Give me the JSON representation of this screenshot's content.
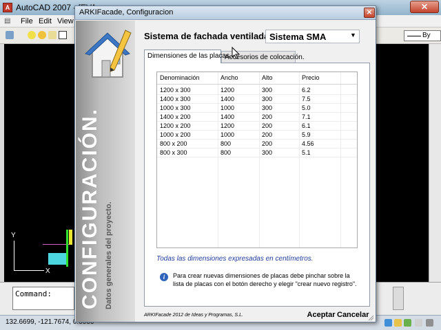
{
  "acad": {
    "app_icon": "A",
    "title": "AutoCAD 2007 - [EVA",
    "close_glyph": "✕",
    "menu": [
      "File",
      "Edit",
      "View"
    ],
    "toolbar_right_combo": "By",
    "axis_y": "Y",
    "axis_x": "X",
    "command_prompt": "Command:",
    "status_coords": "132.6699, -121.7674, 0.0000",
    "icons": [
      "autocad-logo-icon",
      "layer-light-icon",
      "sun-icon",
      "lock-icon",
      "color-swatch-icon",
      "lineweight-icon",
      "tray-icon"
    ]
  },
  "dialog": {
    "title": "ARKIFacade, Configuracion",
    "close_glyph": "✕",
    "sidebar": {
      "title": "CONFIGURACIÓN.",
      "subtitle": "Datos generales del proyecto.",
      "logo_icon": "house-pencil-icon"
    },
    "system_label": "Sistema de fachada ventilada:",
    "system_value": "Sistema SMA",
    "dropdown_glyph": "▼",
    "tabs": [
      {
        "label": "Dimensiones de las placas.",
        "active": true
      },
      {
        "label": "Accesorios de colocación.",
        "active": false
      }
    ],
    "grid": {
      "columns": [
        "Denominación",
        "Ancho",
        "Alto",
        "Precio"
      ],
      "rows": [
        [
          "1200 x 300",
          "1200",
          "300",
          "6.2"
        ],
        [
          "1400 x 300",
          "1400",
          "300",
          "7.5"
        ],
        [
          "1000 x 300",
          "1000",
          "300",
          "5.0"
        ],
        [
          "1400 x 200",
          "1400",
          "200",
          "7.1"
        ],
        [
          "1200 x 200",
          "1200",
          "200",
          "6.1"
        ],
        [
          "1000 x 200",
          "1000",
          "200",
          "5.9"
        ],
        [
          "800 x 200",
          "800",
          "200",
          "4.56"
        ],
        [
          "800 x 300",
          "800",
          "300",
          "5.1"
        ]
      ]
    },
    "dims_note": "Todas las dimensiones expresadas en centímetros.",
    "info_icon_glyph": "i",
    "info_text": "Para crear nuevas dimensiones de placas debe pinchar sobre la lista de placas con el botón derecho y elegir \"crear nuevo registro\".",
    "footer_brand": "ARKIFacade 2012 de Ideas y Programas, S.L.",
    "accept_label": "Aceptar",
    "cancel_label": "Cancelar"
  }
}
